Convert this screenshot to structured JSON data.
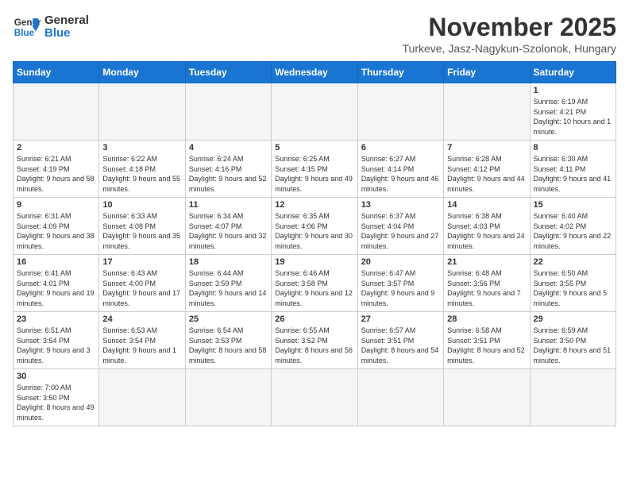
{
  "logo": {
    "text_general": "General",
    "text_blue": "Blue"
  },
  "title": "November 2025",
  "subtitle": "Turkeve, Jasz-Nagykun-Szolonok, Hungary",
  "days_of_week": [
    "Sunday",
    "Monday",
    "Tuesday",
    "Wednesday",
    "Thursday",
    "Friday",
    "Saturday"
  ],
  "weeks": [
    [
      {
        "day": "",
        "info": "",
        "empty": true
      },
      {
        "day": "",
        "info": "",
        "empty": true
      },
      {
        "day": "",
        "info": "",
        "empty": true
      },
      {
        "day": "",
        "info": "",
        "empty": true
      },
      {
        "day": "",
        "info": "",
        "empty": true
      },
      {
        "day": "",
        "info": "",
        "empty": true
      },
      {
        "day": "1",
        "info": "Sunrise: 6:19 AM\nSunset: 4:21 PM\nDaylight: 10 hours and 1 minute.",
        "empty": false
      }
    ],
    [
      {
        "day": "2",
        "info": "Sunrise: 6:21 AM\nSunset: 4:19 PM\nDaylight: 9 hours and 58 minutes.",
        "empty": false
      },
      {
        "day": "3",
        "info": "Sunrise: 6:22 AM\nSunset: 4:18 PM\nDaylight: 9 hours and 55 minutes.",
        "empty": false
      },
      {
        "day": "4",
        "info": "Sunrise: 6:24 AM\nSunset: 4:16 PM\nDaylight: 9 hours and 52 minutes.",
        "empty": false
      },
      {
        "day": "5",
        "info": "Sunrise: 6:25 AM\nSunset: 4:15 PM\nDaylight: 9 hours and 49 minutes.",
        "empty": false
      },
      {
        "day": "6",
        "info": "Sunrise: 6:27 AM\nSunset: 4:14 PM\nDaylight: 9 hours and 46 minutes.",
        "empty": false
      },
      {
        "day": "7",
        "info": "Sunrise: 6:28 AM\nSunset: 4:12 PM\nDaylight: 9 hours and 44 minutes.",
        "empty": false
      },
      {
        "day": "8",
        "info": "Sunrise: 6:30 AM\nSunset: 4:11 PM\nDaylight: 9 hours and 41 minutes.",
        "empty": false
      }
    ],
    [
      {
        "day": "9",
        "info": "Sunrise: 6:31 AM\nSunset: 4:09 PM\nDaylight: 9 hours and 38 minutes.",
        "empty": false
      },
      {
        "day": "10",
        "info": "Sunrise: 6:33 AM\nSunset: 4:08 PM\nDaylight: 9 hours and 35 minutes.",
        "empty": false
      },
      {
        "day": "11",
        "info": "Sunrise: 6:34 AM\nSunset: 4:07 PM\nDaylight: 9 hours and 32 minutes.",
        "empty": false
      },
      {
        "day": "12",
        "info": "Sunrise: 6:35 AM\nSunset: 4:06 PM\nDaylight: 9 hours and 30 minutes.",
        "empty": false
      },
      {
        "day": "13",
        "info": "Sunrise: 6:37 AM\nSunset: 4:04 PM\nDaylight: 9 hours and 27 minutes.",
        "empty": false
      },
      {
        "day": "14",
        "info": "Sunrise: 6:38 AM\nSunset: 4:03 PM\nDaylight: 9 hours and 24 minutes.",
        "empty": false
      },
      {
        "day": "15",
        "info": "Sunrise: 6:40 AM\nSunset: 4:02 PM\nDaylight: 9 hours and 22 minutes.",
        "empty": false
      }
    ],
    [
      {
        "day": "16",
        "info": "Sunrise: 6:41 AM\nSunset: 4:01 PM\nDaylight: 9 hours and 19 minutes.",
        "empty": false
      },
      {
        "day": "17",
        "info": "Sunrise: 6:43 AM\nSunset: 4:00 PM\nDaylight: 9 hours and 17 minutes.",
        "empty": false
      },
      {
        "day": "18",
        "info": "Sunrise: 6:44 AM\nSunset: 3:59 PM\nDaylight: 9 hours and 14 minutes.",
        "empty": false
      },
      {
        "day": "19",
        "info": "Sunrise: 6:46 AM\nSunset: 3:58 PM\nDaylight: 9 hours and 12 minutes.",
        "empty": false
      },
      {
        "day": "20",
        "info": "Sunrise: 6:47 AM\nSunset: 3:57 PM\nDaylight: 9 hours and 9 minutes.",
        "empty": false
      },
      {
        "day": "21",
        "info": "Sunrise: 6:48 AM\nSunset: 3:56 PM\nDaylight: 9 hours and 7 minutes.",
        "empty": false
      },
      {
        "day": "22",
        "info": "Sunrise: 6:50 AM\nSunset: 3:55 PM\nDaylight: 9 hours and 5 minutes.",
        "empty": false
      }
    ],
    [
      {
        "day": "23",
        "info": "Sunrise: 6:51 AM\nSunset: 3:54 PM\nDaylight: 9 hours and 3 minutes.",
        "empty": false
      },
      {
        "day": "24",
        "info": "Sunrise: 6:53 AM\nSunset: 3:54 PM\nDaylight: 9 hours and 1 minute.",
        "empty": false
      },
      {
        "day": "25",
        "info": "Sunrise: 6:54 AM\nSunset: 3:53 PM\nDaylight: 8 hours and 58 minutes.",
        "empty": false
      },
      {
        "day": "26",
        "info": "Sunrise: 6:55 AM\nSunset: 3:52 PM\nDaylight: 8 hours and 56 minutes.",
        "empty": false
      },
      {
        "day": "27",
        "info": "Sunrise: 6:57 AM\nSunset: 3:51 PM\nDaylight: 8 hours and 54 minutes.",
        "empty": false
      },
      {
        "day": "28",
        "info": "Sunrise: 6:58 AM\nSunset: 3:51 PM\nDaylight: 8 hours and 52 minutes.",
        "empty": false
      },
      {
        "day": "29",
        "info": "Sunrise: 6:59 AM\nSunset: 3:50 PM\nDaylight: 8 hours and 51 minutes.",
        "empty": false
      }
    ],
    [
      {
        "day": "30",
        "info": "Sunrise: 7:00 AM\nSunset: 3:50 PM\nDaylight: 8 hours and 49 minutes.",
        "empty": false
      },
      {
        "day": "",
        "info": "",
        "empty": true
      },
      {
        "day": "",
        "info": "",
        "empty": true
      },
      {
        "day": "",
        "info": "",
        "empty": true
      },
      {
        "day": "",
        "info": "",
        "empty": true
      },
      {
        "day": "",
        "info": "",
        "empty": true
      },
      {
        "day": "",
        "info": "",
        "empty": true
      }
    ]
  ]
}
